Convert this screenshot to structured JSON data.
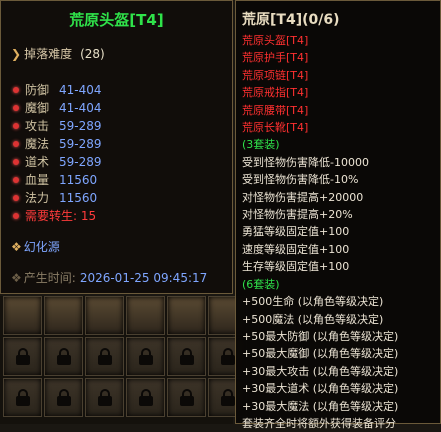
{
  "item": {
    "name": "荒原头盔[T4]",
    "drop_label": "掉落难度",
    "drop_value": "(28)",
    "stats": [
      {
        "name": "防御",
        "value": "41-404"
      },
      {
        "name": "魔御",
        "value": "41-404"
      },
      {
        "name": "攻击",
        "value": "59-289"
      },
      {
        "name": "魔法",
        "value": "59-289"
      },
      {
        "name": "道术",
        "value": "59-289"
      },
      {
        "name": "血量",
        "value": "11560"
      },
      {
        "name": "法力",
        "value": "11560"
      }
    ],
    "requirement": {
      "name": "需要转生:",
      "value": "15"
    },
    "huanhua": "幻化源",
    "time_label": "产生时间:",
    "time_value": "2026-01-25 09:45:17"
  },
  "set": {
    "title": "荒原[T4](0/6)",
    "pieces": [
      "荒原头盔[T4]",
      "荒原护手[T4]",
      "荒原项链[T4]",
      "荒原戒指[T4]",
      "荒原腰带[T4]",
      "荒原长靴[T4]"
    ],
    "bonus3_header": "(3套装)",
    "bonus3": [
      "受到怪物伤害降低-10000",
      "受到怪物伤害降低-10%",
      "对怪物伤害提高+20000",
      "对怪物伤害提高+20%",
      "勇猛等级固定值+100",
      "速度等级固定值+100",
      "生存等级固定值+100"
    ],
    "bonus6_header": "(6套装)",
    "bonus6": [
      "+500生命 (以角色等级决定)",
      "+500魔法 (以角色等级决定)",
      "+50最大防御 (以角色等级决定)",
      "+50最大魔御 (以角色等级决定)",
      "+30最大攻击 (以角色等级决定)",
      "+30最大道术 (以角色等级决定)",
      "+30最大魔法 (以角色等级决定)"
    ],
    "footer": "套装齐全时将额外获得装备评分"
  },
  "colors": {
    "item_name": "#2fe24a",
    "stat_value": "#7fa6ff",
    "requirement": "#ff3b3b",
    "set_piece_missing": "#ff3030",
    "set_header": "#2fe24a"
  },
  "inventory": {
    "slot_icon": "lock-icon"
  }
}
